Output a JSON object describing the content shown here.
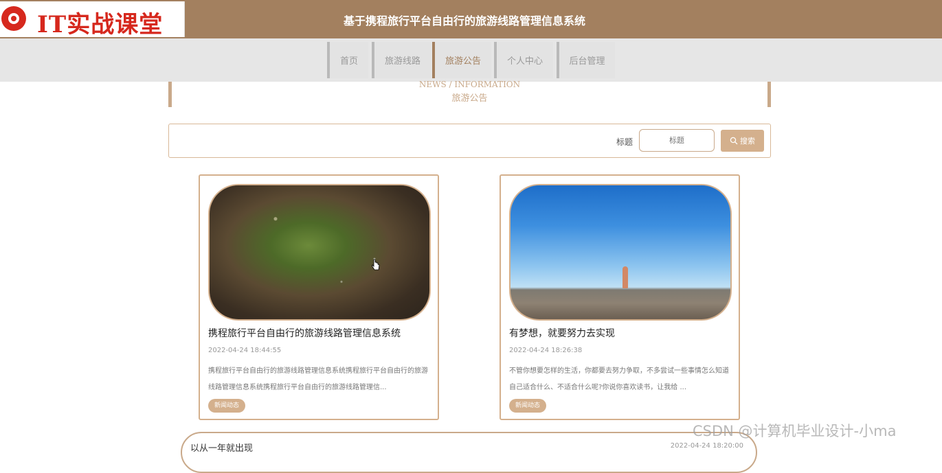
{
  "header": {
    "logo_text": "IT实战课堂",
    "site_title": "基于携程旅行平台自由行的旅游线路管理信息系统"
  },
  "nav": {
    "items": [
      {
        "label": "首页"
      },
      {
        "label": "旅游线路"
      },
      {
        "label": "旅游公告"
      },
      {
        "label": "个人中心"
      },
      {
        "label": "后台管理"
      }
    ],
    "active": "旅游公告"
  },
  "banner": {
    "en": "NEWS / INFORMATION",
    "cn": "旅游公告"
  },
  "search": {
    "label": "标题",
    "placeholder": "标题",
    "button_label": "搜索"
  },
  "cards": [
    {
      "title": "携程旅行平台自由行的旅游线路管理信息系统",
      "date": "2022-04-24 18:44:55",
      "excerpt": "携程旅行平台自由行的旅游线路管理信息系统携程旅行平台自由行的旅游线路管理信息系统携程旅行平台自由行的旅游线路管理信...",
      "tag": "新闻动态"
    },
    {
      "title": "有梦想，就要努力去实现",
      "date": "2022-04-24 18:26:38",
      "excerpt": "不管你想要怎样的生活，你都要去努力争取，不多尝试一些事情怎么知道自己适合什么、不适合什么呢?你说你喜欢读书，让我给 ...",
      "tag": "新闻动态"
    }
  ],
  "bottom_card": {
    "title": "以从一年就出现",
    "date": "2022-04-24 18:20:00"
  },
  "watermark": "CSDN @计算机毕业设计-小ma"
}
